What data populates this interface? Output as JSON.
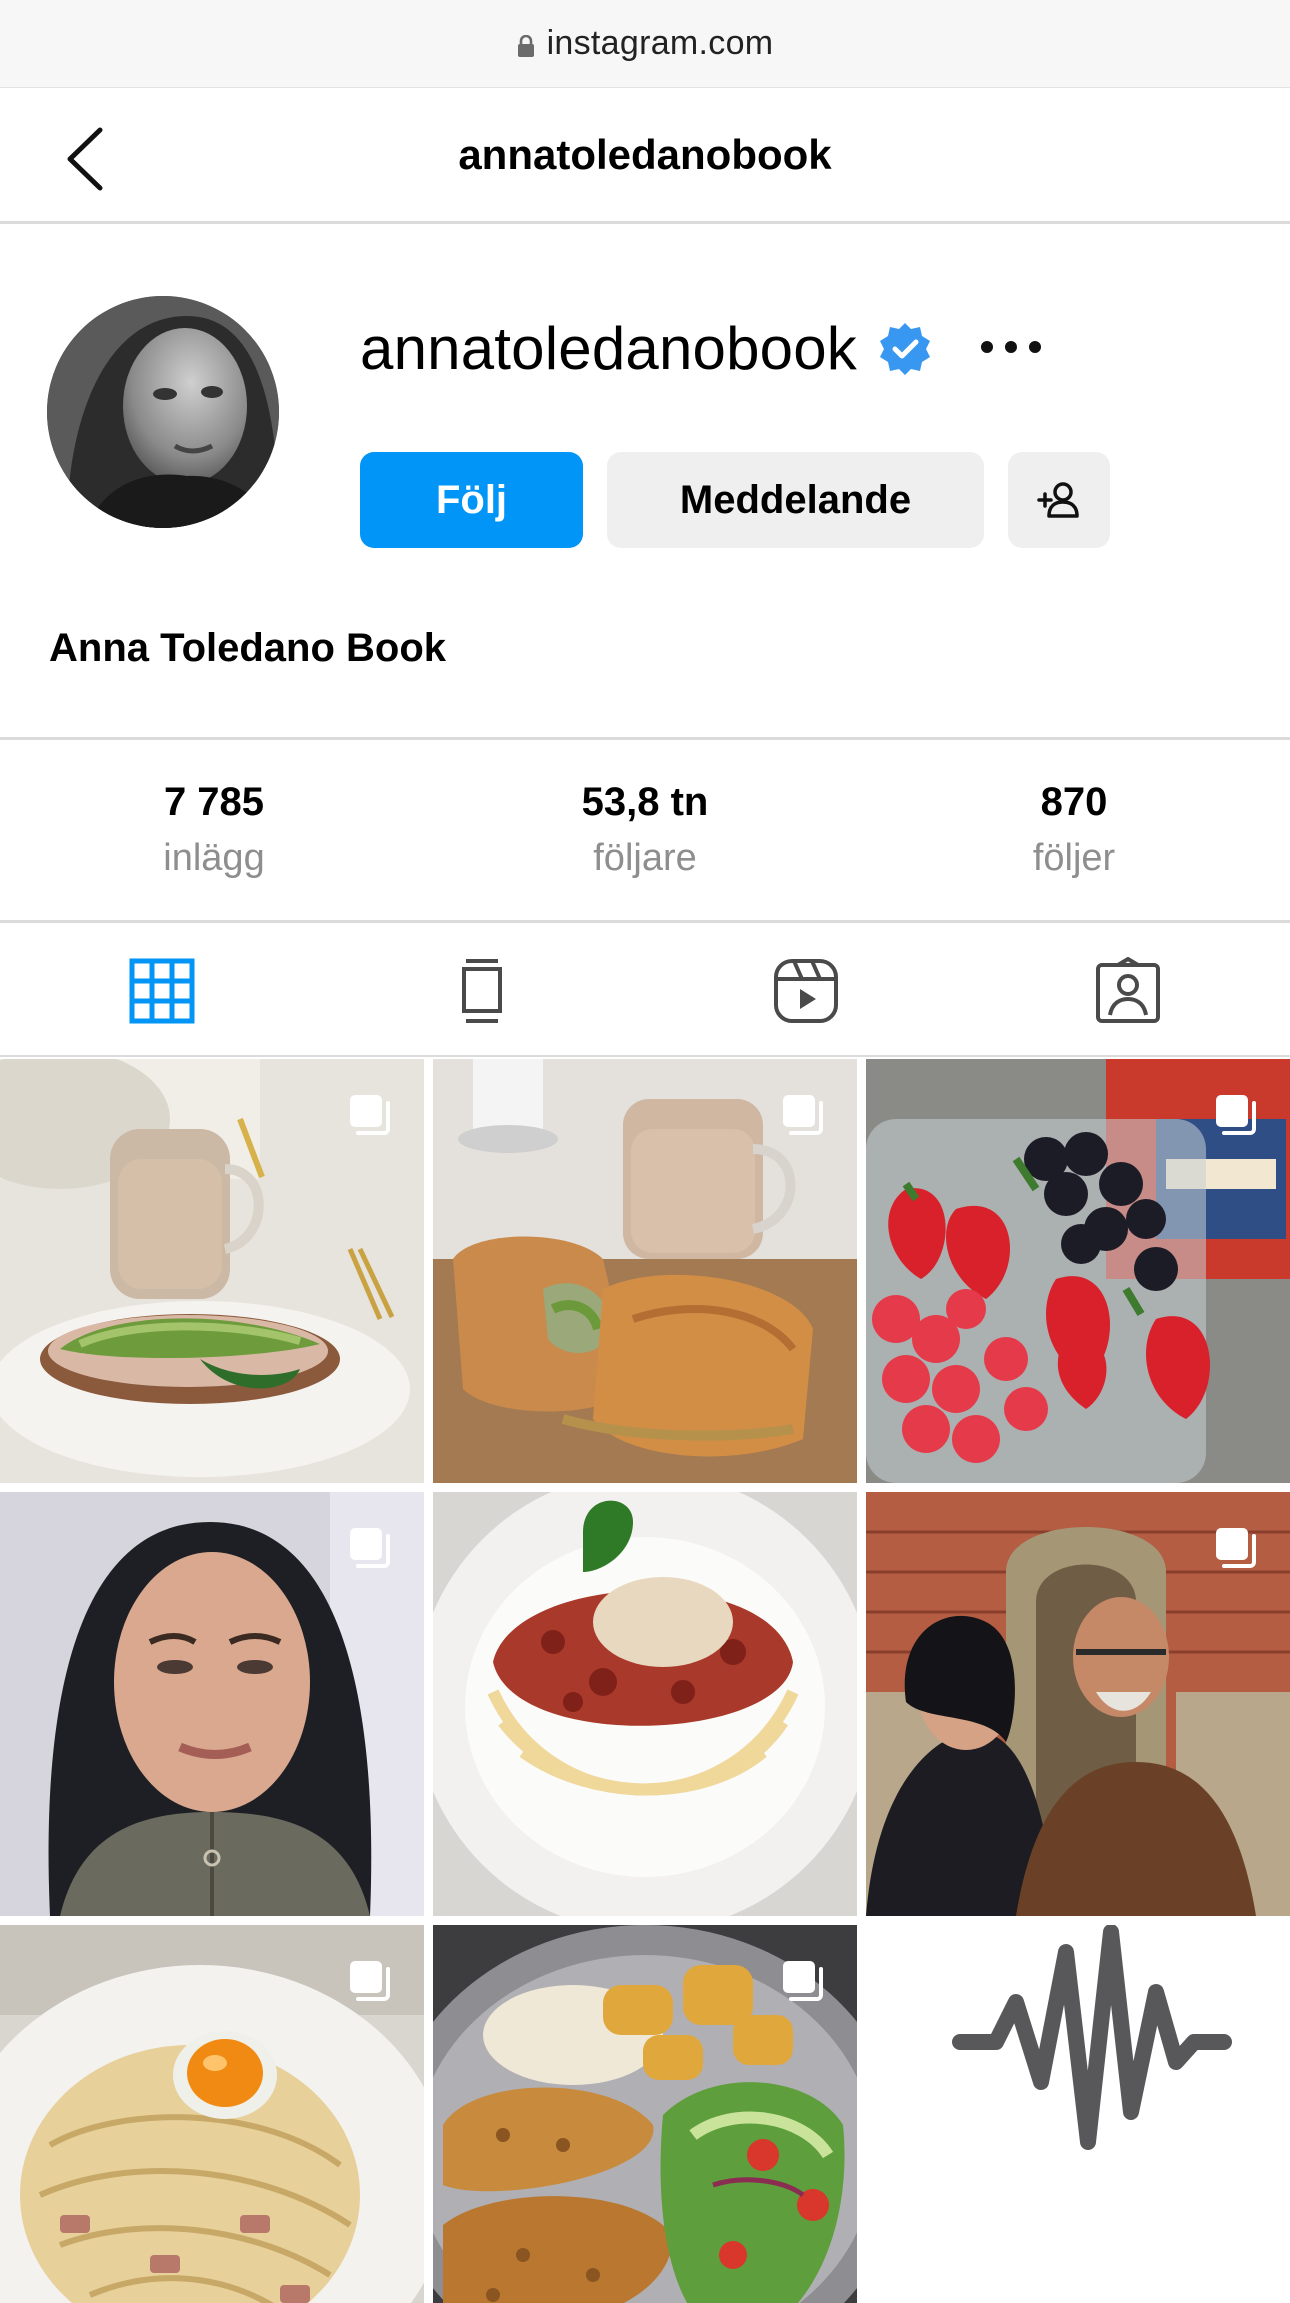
{
  "browser": {
    "url": "instagram.com"
  },
  "header": {
    "title": "annatoledanobook"
  },
  "profile": {
    "username": "annatoledanobook",
    "full_name": "Anna Toledano Book",
    "verified": true,
    "follow_label": "Följ",
    "message_label": "Meddelande"
  },
  "stats": [
    {
      "value": "7 785",
      "label": "inlägg"
    },
    {
      "value": "53,8 tn",
      "label": "följare"
    },
    {
      "value": "870",
      "label": "följer"
    }
  ],
  "tabs": [
    {
      "icon": "grid-icon",
      "active": true
    },
    {
      "icon": "feed-icon",
      "active": false
    },
    {
      "icon": "reels-icon",
      "active": false
    },
    {
      "icon": "tagged-icon",
      "active": false
    }
  ],
  "colors": {
    "accent": "#0095f6",
    "muted": "#8e8e8e",
    "divider": "#dbdbdb"
  },
  "posts": [
    {
      "subject": "avocado toast with coffee",
      "multi": true
    },
    {
      "subject": "toasted wrap with coffee",
      "multi": true
    },
    {
      "subject": "berries and strawberries",
      "multi": true
    },
    {
      "subject": "woman selfie",
      "multi": true
    },
    {
      "subject": "spaghetti bolognese",
      "multi": false
    },
    {
      "subject": "couple in front of church",
      "multi": true
    },
    {
      "subject": "spaghetti carbonara",
      "multi": true
    },
    {
      "subject": "schnitzel with potatoes and salad",
      "multi": true
    },
    {
      "subject": "audio waveform",
      "multi": false
    }
  ]
}
